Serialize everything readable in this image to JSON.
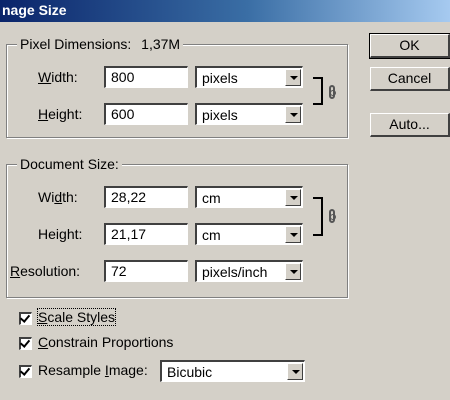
{
  "window": {
    "title": "nage Size"
  },
  "buttons": {
    "ok": "OK",
    "cancel": "Cancel",
    "auto": "Auto..."
  },
  "pixel_dimensions": {
    "label": "Pixel Dimensions:",
    "size": "1,37M",
    "width": {
      "label_mn": "W",
      "label_rest": "idth:",
      "value": "800",
      "unit": "pixels"
    },
    "height": {
      "label_mn": "H",
      "label_rest": "eight:",
      "value": "600",
      "unit": "pixels"
    }
  },
  "document_size": {
    "label": "Document Size:",
    "width": {
      "label_pre": "Wi",
      "label_mn": "d",
      "label_rest": "th:",
      "value": "28,22",
      "unit": "cm"
    },
    "height": {
      "label_pre": "Hei",
      "label_mn": "g",
      "label_rest": "ht:",
      "value": "21,17",
      "unit": "cm"
    },
    "resolution": {
      "label_mn": "R",
      "label_rest": "esolution:",
      "value": "72",
      "unit": "pixels/inch"
    }
  },
  "options": {
    "scale_styles": {
      "label_mn": "S",
      "label_rest": "cale Styles",
      "checked": true
    },
    "constrain": {
      "label_mn": "C",
      "label_rest": "onstrain Proportions",
      "checked": true
    },
    "resample": {
      "label_pre": "Resample ",
      "label_mn": "I",
      "label_rest": "mage:",
      "checked": true,
      "method": "Bicubic"
    }
  }
}
